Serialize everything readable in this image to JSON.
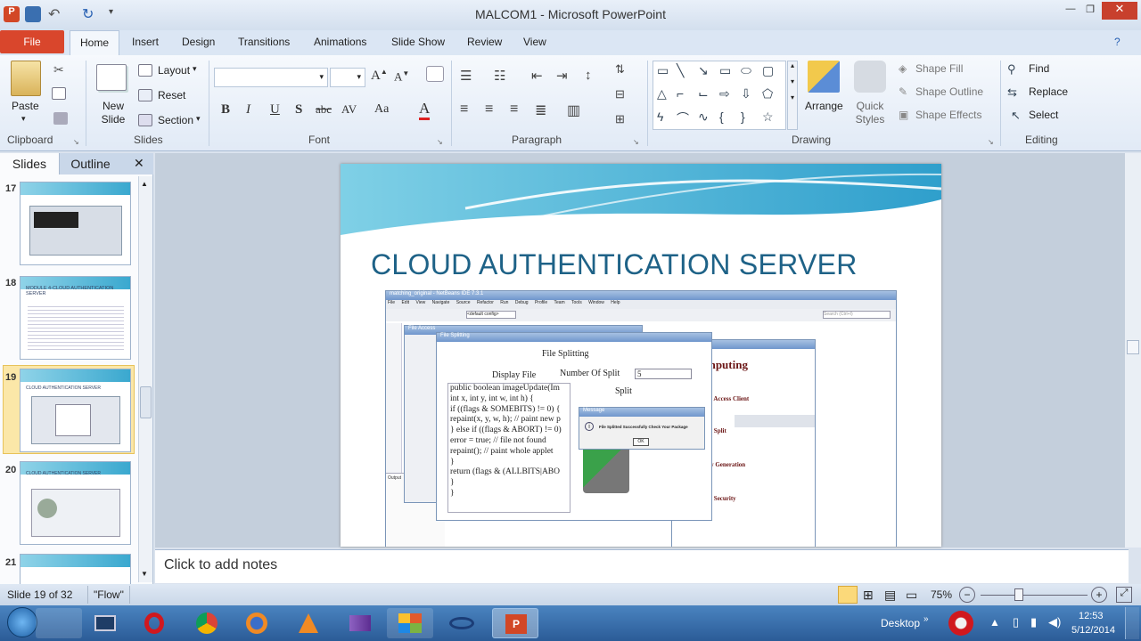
{
  "window": {
    "title": "MALCOM1 - Microsoft PowerPoint"
  },
  "tabs": [
    "File",
    "Home",
    "Insert",
    "Design",
    "Transitions",
    "Animations",
    "Slide Show",
    "Review",
    "View"
  ],
  "ribbon": {
    "clipboard": {
      "label": "Clipboard",
      "paste": "Paste"
    },
    "slides": {
      "label": "Slides",
      "new_slide": "New Slide",
      "layout": "Layout",
      "reset": "Reset",
      "section": "Section"
    },
    "font": {
      "label": "Font"
    },
    "paragraph": {
      "label": "Paragraph"
    },
    "drawing": {
      "label": "Drawing",
      "arrange": "Arrange",
      "quick_styles": "Quick Styles",
      "shape_fill": "Shape Fill",
      "shape_outline": "Shape Outline",
      "shape_effects": "Shape Effects"
    },
    "editing": {
      "label": "Editing",
      "find": "Find",
      "replace": "Replace",
      "select": "Select"
    }
  },
  "panel": {
    "tab_slides": "Slides",
    "tab_outline": "Outline",
    "thumbs": [
      {
        "num": "17",
        "text": ""
      },
      {
        "num": "18",
        "text": "MODULE 4-CLOUD AUTHENTICATION SERVER"
      },
      {
        "num": "19",
        "text": "CLOUD AUTHENTICATION SERVER"
      },
      {
        "num": "20",
        "text": "CLOUD AUTHENTICATION SERVER"
      },
      {
        "num": "21",
        "text": ""
      }
    ]
  },
  "slide": {
    "title": "CLOUD AUTHENTICATION SERVER",
    "embedded": {
      "netbeans_title": "matching_original - NetBeans IDE 7.3.1",
      "menu": [
        "File",
        "Edit",
        "View",
        "Navigate",
        "Source",
        "Refactor",
        "Run",
        "Debug",
        "Profile",
        "Team",
        "Tools",
        "Window",
        "Help"
      ],
      "config": "<default config>",
      "search_placeholder": "Search (Ctrl+I)",
      "file_access_title": "File Access",
      "file_splitting_title": "File Splitting",
      "heading": "File Splitting",
      "display_file": "Display File",
      "number_of_split": "Number Of Split",
      "split_value": "5",
      "split_button": "Split",
      "code": [
        "public boolean imageUpdate(Im",
        "int x, int y, int w, int h) {",
        "if ((flags & SOMEBITS) != 0) {",
        "repaint(x, y, w, h); // paint new p",
        "} else if ((flags & ABORT) != 0)",
        "error = true; // file not found",
        "repaint(); // paint whole applet",
        "}",
        "return (flags & (ALLBITS|ABO",
        "}",
        "}"
      ],
      "message_title": "Message",
      "message_text": "File Splitted Successfully Check Your Package",
      "ok": "OK",
      "computing": "mputing",
      "right_items": [
        "le Access Client",
        "le Split",
        "ey Generation",
        "le Security"
      ],
      "output_label": "Output"
    }
  },
  "notes": {
    "placeholder": "Click to add notes"
  },
  "status": {
    "slide_info": "Slide 19 of 32",
    "theme": "\"Flow\"",
    "zoom": "75%"
  },
  "taskbar": {
    "desktop": "Desktop",
    "time": "12:53",
    "date": "5/12/2014"
  }
}
